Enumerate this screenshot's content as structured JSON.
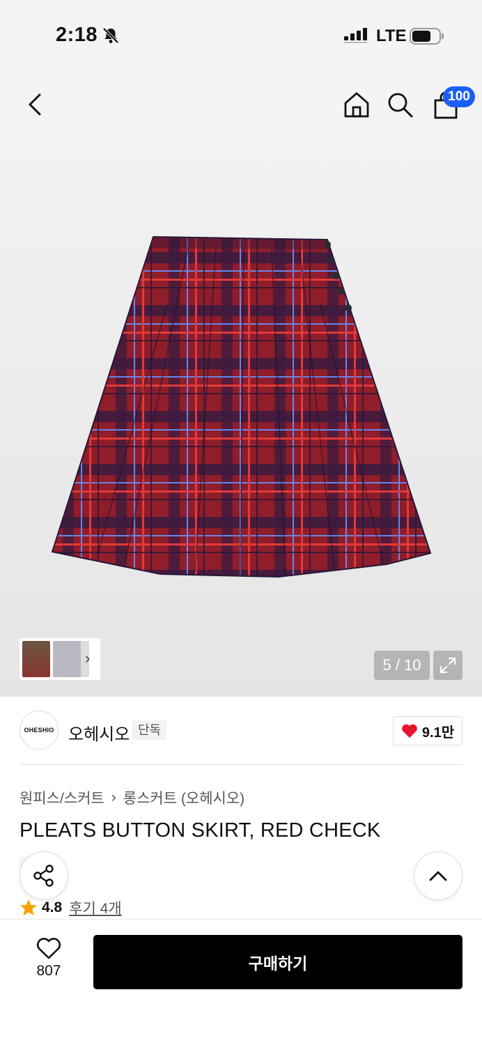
{
  "status_bar": {
    "time": "2:18",
    "network": "LTE"
  },
  "nav": {
    "cart_count": "100"
  },
  "gallery": {
    "page_counter": "5 / 10",
    "thumbnail_chevron": "›"
  },
  "brand": {
    "logo_text": "OHESHIO",
    "name": "오헤시오",
    "tag": "단독",
    "likes": "9.1만"
  },
  "breadcrumb": {
    "category": "원피스/스커트",
    "separator": "›",
    "subcategory": "롱스커트 (오헤시오)"
  },
  "product": {
    "title": "PLEATS BUTTON SKIRT, RED CHECK",
    "tag": "단독",
    "rating": "4.8",
    "reviews": "후기 4개"
  },
  "bottom_bar": {
    "wish_count": "807",
    "buy_label": "구매하기"
  },
  "colors": {
    "accent_badge": "#1d5ff5",
    "heart": "#e8132d",
    "star": "#f5a300",
    "buy_button": "#000000",
    "plaid_base": "#8f1d2a"
  },
  "icons": [
    "bell-off-icon",
    "signal-icon",
    "battery-icon",
    "back-icon",
    "home-icon",
    "search-icon",
    "cart-icon",
    "expand-icon",
    "heart-icon",
    "share-icon",
    "chevron-up-icon",
    "star-icon",
    "heart-outline-icon"
  ]
}
